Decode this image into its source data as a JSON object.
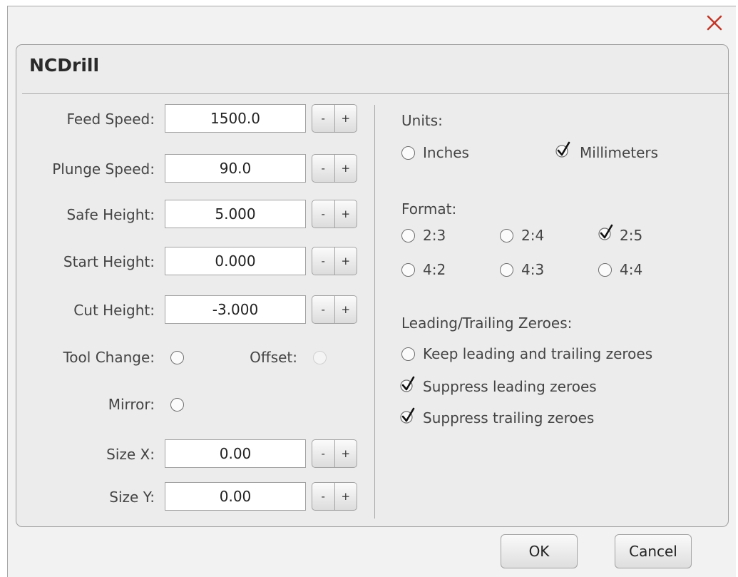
{
  "dialog": {
    "title": "NCDrill",
    "close_icon": "close-icon",
    "accent_close": "#c0392b"
  },
  "left": {
    "fields": [
      {
        "label": "Feed Speed:",
        "value": "1500.0"
      },
      {
        "label": "Plunge Speed:",
        "value": "90.0"
      },
      {
        "label": "Safe Height:",
        "value": "5.000"
      },
      {
        "label": "Start Height:",
        "value": "0.000"
      },
      {
        "label": "Cut Height:",
        "value": "-3.000"
      }
    ],
    "tool_change_label": "Tool Change:",
    "offset_label": "Offset:",
    "mirror_label": "Mirror:",
    "size_fields": [
      {
        "label": "Size X:",
        "value": "0.00"
      },
      {
        "label": "Size Y:",
        "value": "0.00"
      }
    ],
    "stepper_minus": "-",
    "stepper_plus": "+"
  },
  "right": {
    "units_label": "Units:",
    "units_options": [
      {
        "label": "Inches",
        "selected": false
      },
      {
        "label": "Millimeters",
        "selected": true
      }
    ],
    "format_label": "Format:",
    "format_options": [
      {
        "label": "2:3",
        "selected": false
      },
      {
        "label": "2:4",
        "selected": false
      },
      {
        "label": "2:5",
        "selected": true
      },
      {
        "label": "4:2",
        "selected": false
      },
      {
        "label": "4:3",
        "selected": false
      },
      {
        "label": "4:4",
        "selected": false
      }
    ],
    "zeroes_label": "Leading/Trailing Zeroes:",
    "zeroes_options": [
      {
        "label": "Keep leading and trailing zeroes",
        "selected": false
      },
      {
        "label": "Suppress leading zeroes",
        "selected": true
      },
      {
        "label": "Suppress trailing zeroes",
        "selected": true
      }
    ]
  },
  "footer": {
    "ok_label": "OK",
    "cancel_label": "Cancel"
  }
}
